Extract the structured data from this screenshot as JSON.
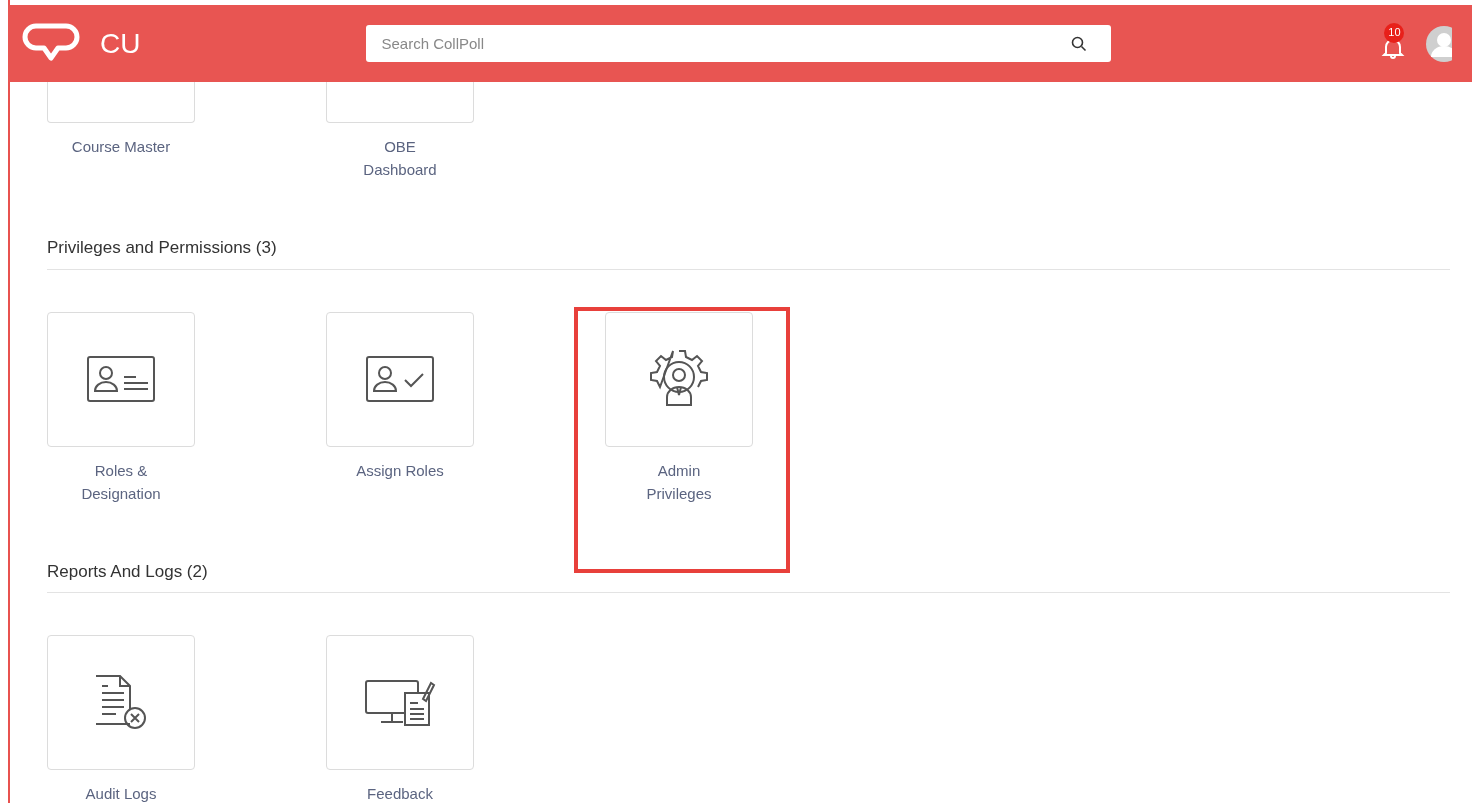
{
  "header": {
    "logo_text": "CU",
    "search": {
      "placeholder": "Search CollPoll"
    },
    "notification_count": "10"
  },
  "sections": [
    {
      "items": [
        {
          "label": "Course Master",
          "highlighted": false
        },
        {
          "label": "OBE Dashboard",
          "highlighted": false
        }
      ]
    },
    {
      "heading": "Privileges and Permissions (3)",
      "items": [
        {
          "label": "Roles & Designation",
          "highlighted": false
        },
        {
          "label": "Assign Roles",
          "highlighted": false
        },
        {
          "label": "Admin Privileges",
          "highlighted": true
        }
      ]
    },
    {
      "heading": "Reports And Logs (2)",
      "items": [
        {
          "label": "Audit Logs",
          "highlighted": false
        },
        {
          "label": "Feedback",
          "highlighted": false
        }
      ]
    }
  ]
}
